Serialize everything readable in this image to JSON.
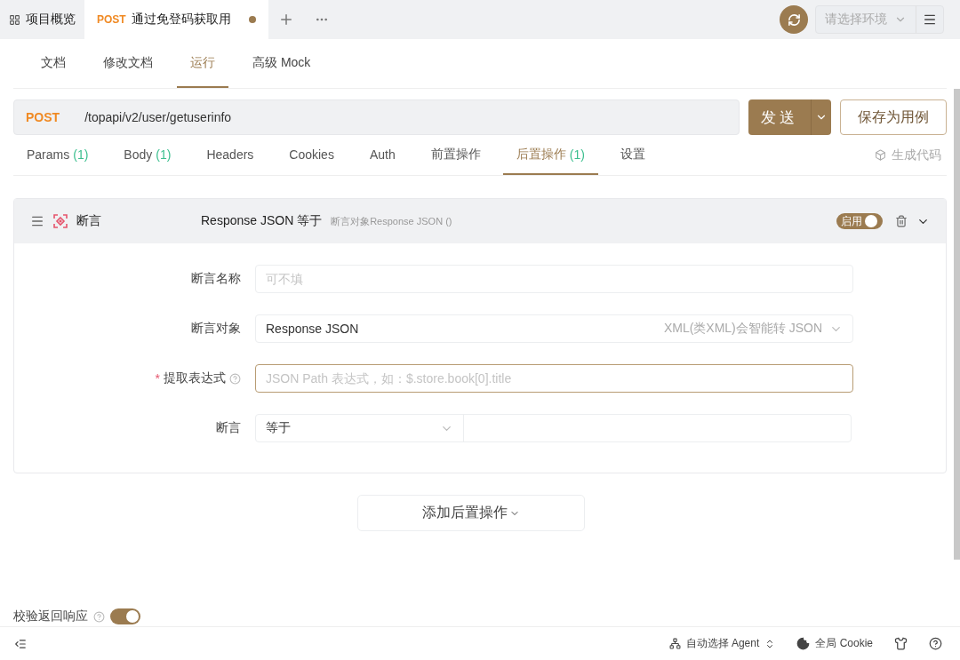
{
  "top_tabs": [
    {
      "kind": "overview",
      "label": "项目概览",
      "selected": false
    },
    {
      "kind": "request",
      "method": "POST",
      "label": "通过免登码获取用",
      "selected": true,
      "unsaved": true
    }
  ],
  "environment": {
    "placeholder": "请选择环境"
  },
  "view_tabs": [
    {
      "label": "文档",
      "selected": false
    },
    {
      "label": "修改文档",
      "selected": false
    },
    {
      "label": "运行",
      "selected": true
    },
    {
      "label": "高级 Mock",
      "selected": false
    }
  ],
  "request": {
    "method": "POST",
    "url": "/topapi/v2/user/getuserinfo",
    "send_button": "发送",
    "save_button": "保存为用例"
  },
  "request_tabs": [
    {
      "label": "Params",
      "count": "(1)",
      "selected": false
    },
    {
      "label": "Body",
      "count": "(1)",
      "selected": false
    },
    {
      "label": "Headers",
      "selected": false
    },
    {
      "label": "Cookies",
      "selected": false
    },
    {
      "label": "Auth",
      "selected": false
    },
    {
      "label": "前置操作",
      "selected": false
    },
    {
      "label": "后置操作",
      "count": "(1)",
      "selected": true
    },
    {
      "label": "设置",
      "selected": false
    }
  ],
  "generate_code": "生成代码",
  "post_operation": {
    "type": "断言",
    "summary": "Response JSON 等于",
    "detail": "断言对象Response JSON ()",
    "enabled": true,
    "enabled_label": "启用",
    "expanded": true,
    "fields": [
      {
        "kind": "text",
        "label": "断言名称",
        "placeholder": "可不填",
        "help": false,
        "focused": false
      },
      {
        "kind": "select",
        "label": "断言对象",
        "value": "Response JSON",
        "hint": "XML(类XML)会智能转 JSON",
        "help": false,
        "focused": false
      },
      {
        "kind": "text",
        "label": "提取表达式",
        "placeholder": "JSON Path 表达式，如：$.store.book[0].title",
        "required_mark": "*",
        "help": true,
        "focused": true
      },
      {
        "kind": "compare",
        "label": "断言",
        "value": "等于",
        "help": false,
        "focused": false
      }
    ]
  },
  "add_button": "添加后置操作",
  "validate_response": {
    "label": "校验返回响应",
    "on": true
  },
  "status_bar": {
    "agent": "自动选择 Agent",
    "cookie": "全局 Cookie"
  }
}
